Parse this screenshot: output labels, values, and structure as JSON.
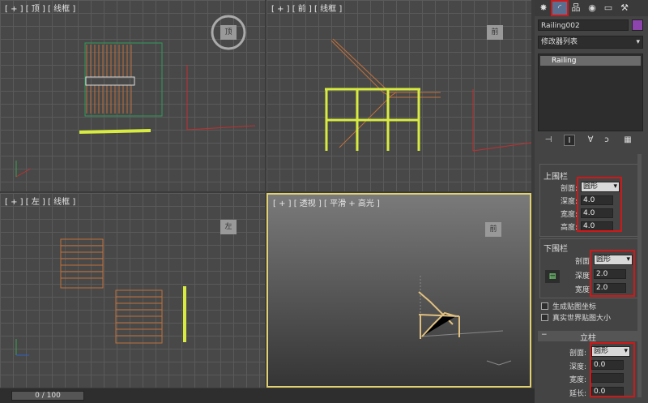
{
  "viewports": {
    "top": {
      "label": "[ + ] [ 顶 ] [ 线框 ]"
    },
    "front": {
      "label": "[ + ] [ 前 ] [ 线框 ]"
    },
    "left": {
      "label": "[ + ] [ 左 ] [ 线框 ]"
    },
    "persp": {
      "label": "[ + ] [ 透视 ] [ 平滑 + 高光 ]"
    }
  },
  "viewcube": {
    "top": "顶",
    "front": "前",
    "left": "左",
    "persp": "前"
  },
  "panel": {
    "object_name": "Railing002",
    "object_color": "#8e44ad",
    "modifier_list": "修改器列表",
    "stack_item": "Railing",
    "upper_rail": {
      "title": "上围栏",
      "profile_label": "剖面:",
      "profile_value": "圆形",
      "depth_label": "深度:",
      "depth_value": "4.0",
      "width_label": "宽度:",
      "width_value": "4.0",
      "height_label": "高度:",
      "height_value": "4.0"
    },
    "lower_rail": {
      "title": "下围栏",
      "profile_label": "剖面:",
      "profile_value": "圆形",
      "depth_label": "深度:",
      "depth_value": "2.0",
      "width_label": "宽度:",
      "width_value": "2.0"
    },
    "gen_map_coords": "生成贴图坐标",
    "real_world_map": "真实世界贴图大小",
    "posts": {
      "title": "立柱",
      "profile_label": "剖面:",
      "profile_value": "圆形",
      "depth_label": "深度:",
      "depth_value": "0.0",
      "width_label": "宽度:",
      "extend_label": "延长:",
      "extend_value": "0.0"
    }
  },
  "timeline": {
    "frame": "0 / 100"
  },
  "colors": {
    "accent_red": "#d01818",
    "selection_yellow": "#d8ec40"
  }
}
